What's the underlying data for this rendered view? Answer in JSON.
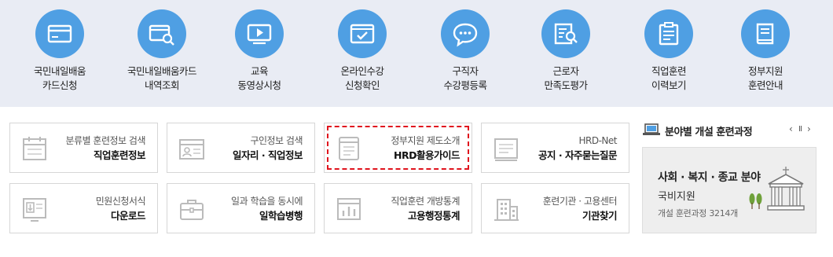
{
  "quick_menu": [
    {
      "icon": "credit-card-icon",
      "line1": "국민내일배움",
      "line2": "카드신청"
    },
    {
      "icon": "card-search-icon",
      "line1": "국민내일배움카드",
      "line2": "내역조회"
    },
    {
      "icon": "video-play-icon",
      "line1": "교육",
      "line2": "동영상시청"
    },
    {
      "icon": "online-check-icon",
      "line1": "온라인수강",
      "line2": "신청확인"
    },
    {
      "icon": "chat-bubble-icon",
      "line1": "구직자",
      "line2": "수강평등록"
    },
    {
      "icon": "document-search-icon",
      "line1": "근로자",
      "line2": "만족도평가"
    },
    {
      "icon": "history-document-icon",
      "line1": "직업훈련",
      "line2": "이력보기"
    },
    {
      "icon": "book-icon",
      "line1": "정부지원",
      "line2": "훈련안내"
    }
  ],
  "tiles": [
    {
      "icon": "calendar-icon",
      "sub": "분류별 훈련정보 검색",
      "main": "직업훈련정보"
    },
    {
      "icon": "id-card-icon",
      "sub": "구인정보 검색",
      "main": "일자리 · 직업정보"
    },
    {
      "icon": "guide-book-icon",
      "sub": "정부지원 제도소개",
      "main": "HRD활용가이드",
      "highlighted": true
    },
    {
      "icon": "notice-board-icon",
      "sub": "HRD-Net",
      "main": "공지 · 자주묻는질문"
    },
    {
      "icon": "download-form-icon",
      "sub": "민원신청서식",
      "main": "다운로드"
    },
    {
      "icon": "briefcase-icon",
      "sub": "일과 학습을 동시에",
      "main": "일학습병행"
    },
    {
      "icon": "statistics-chart-icon",
      "sub": "직업훈련 개방통계",
      "main": "고용행정통계"
    },
    {
      "icon": "building-icon",
      "sub": "훈련기관 · 고용센터",
      "main": "기관찾기"
    }
  ],
  "side": {
    "title": "분야별 개설 훈련과정",
    "prev": "‹",
    "pause": "II",
    "next": "›",
    "card": {
      "title": "사회 · 복지 · 종교 분야",
      "subtitle": "국비지원",
      "count": "개설 훈련과정 3214개"
    }
  },
  "colors": {
    "band": "#e9ecf4",
    "circle": "#4f9fe3",
    "highlight": "#e0141e"
  }
}
